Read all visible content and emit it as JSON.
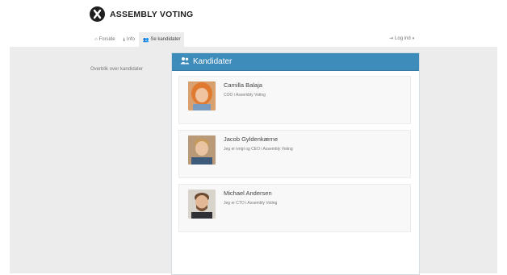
{
  "brand": {
    "name": "ASSEMBLY VOTING"
  },
  "nav": {
    "items": [
      {
        "icon": "home-icon",
        "label": "Forside"
      },
      {
        "icon": "info-icon",
        "label": "Info"
      },
      {
        "icon": "users-icon",
        "label": "Se kandidater"
      }
    ],
    "active_index": 2,
    "login": {
      "icon": "login-icon",
      "label": "Log ind"
    }
  },
  "sidebar": {
    "text": "Overblik over kandidater"
  },
  "panel": {
    "title": "Kandidater",
    "candidates": [
      {
        "name": "Camilla Balaja",
        "role": "COO i Assembly Voting"
      },
      {
        "name": "Jacob Gyldenkærne",
        "role": "Jeg er ivrigt og CEO i Assembly Voting"
      },
      {
        "name": "Michael Andersen",
        "role": "Jeg er CTO i Assembly Voting"
      }
    ]
  },
  "colors": {
    "accent": "#3e8cba",
    "background": "#ececec"
  }
}
